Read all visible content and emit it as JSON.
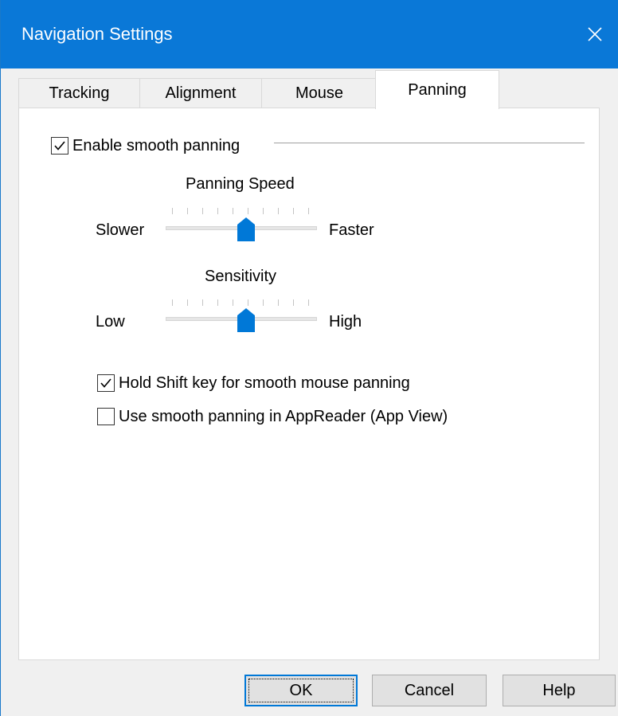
{
  "window": {
    "title": "Navigation Settings"
  },
  "tabs": [
    {
      "label": "Tracking",
      "active": false
    },
    {
      "label": "Alignment",
      "active": false
    },
    {
      "label": "Mouse",
      "active": false
    },
    {
      "label": "Panning",
      "active": true
    }
  ],
  "panning": {
    "enable_smooth": {
      "label": "Enable smooth panning",
      "checked": true
    },
    "speed": {
      "title": "Panning Speed",
      "min_label": "Slower",
      "max_label": "Faster",
      "value": 0.5
    },
    "sensitivity": {
      "title": "Sensitivity",
      "min_label": "Low",
      "max_label": "High",
      "value": 0.5
    },
    "hold_shift": {
      "label": "Hold Shift key for smooth mouse panning",
      "checked": true
    },
    "appreader": {
      "label": "Use smooth panning in AppReader (App View)",
      "checked": false
    }
  },
  "buttons": {
    "ok": "OK",
    "cancel": "Cancel",
    "help": "Help"
  },
  "colors": {
    "accent": "#0078d7",
    "titlebar": "#0a78d7"
  }
}
